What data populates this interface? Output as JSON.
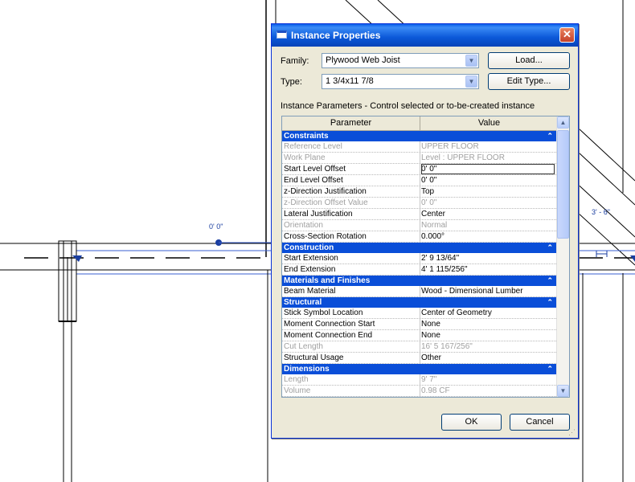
{
  "cad": {
    "label_left": "0' 0\"",
    "label_right": "3' - 6\""
  },
  "dialog": {
    "title": "Instance Properties",
    "close": "✕",
    "family_label": "Family:",
    "family_value": "Plywood Web Joist",
    "type_label": "Type:",
    "type_value": "1 3/4x11 7/8",
    "load_button": "Load...",
    "edit_type_button": "Edit Type...",
    "instance_params_caption": "Instance Parameters - Control selected or to-be-created instance",
    "columns": {
      "parameter": "Parameter",
      "value": "Value"
    },
    "groups": [
      {
        "name": "Constraints",
        "rows": [
          {
            "p": "Reference Level",
            "v": "UPPER FLOOR",
            "disabled": true
          },
          {
            "p": "Work Plane",
            "v": "Level : UPPER FLOOR",
            "disabled": true
          },
          {
            "p": "Start Level Offset",
            "v": "0' 0\"",
            "selected": true
          },
          {
            "p": "End Level Offset",
            "v": "0' 0\""
          },
          {
            "p": "z-Direction Justification",
            "v": "Top"
          },
          {
            "p": "z-Direction Offset Value",
            "v": "0' 0\"",
            "disabled": true
          },
          {
            "p": "Lateral Justification",
            "v": "Center"
          },
          {
            "p": "Orientation",
            "v": "Normal",
            "disabled": true
          },
          {
            "p": "Cross-Section Rotation",
            "v": "0.000°"
          }
        ]
      },
      {
        "name": "Construction",
        "rows": [
          {
            "p": "Start Extension",
            "v": "2' 9 13/64\""
          },
          {
            "p": "End Extension",
            "v": "4' 1 115/256\""
          }
        ]
      },
      {
        "name": "Materials and Finishes",
        "rows": [
          {
            "p": "Beam Material",
            "v": "Wood - Dimensional Lumber"
          }
        ]
      },
      {
        "name": "Structural",
        "rows": [
          {
            "p": "Stick Symbol Location",
            "v": "Center of Geometry"
          },
          {
            "p": "Moment Connection Start",
            "v": "None"
          },
          {
            "p": "Moment Connection End",
            "v": "None"
          },
          {
            "p": "Cut Length",
            "v": "16' 5 167/256\"",
            "disabled": true
          },
          {
            "p": "Structural Usage",
            "v": "Other"
          }
        ]
      },
      {
        "name": "Dimensions",
        "rows": [
          {
            "p": "Length",
            "v": "9' 7\"",
            "disabled": true
          },
          {
            "p": "Volume",
            "v": "0.98 CF",
            "disabled": true
          }
        ]
      }
    ],
    "ok_button": "OK",
    "cancel_button": "Cancel",
    "collapse_glyph": "⌃"
  },
  "colors": {
    "titlebar": "#0b58d8",
    "category_bar": "#0a4ed8",
    "cad_accent": "#1a3ea0"
  }
}
